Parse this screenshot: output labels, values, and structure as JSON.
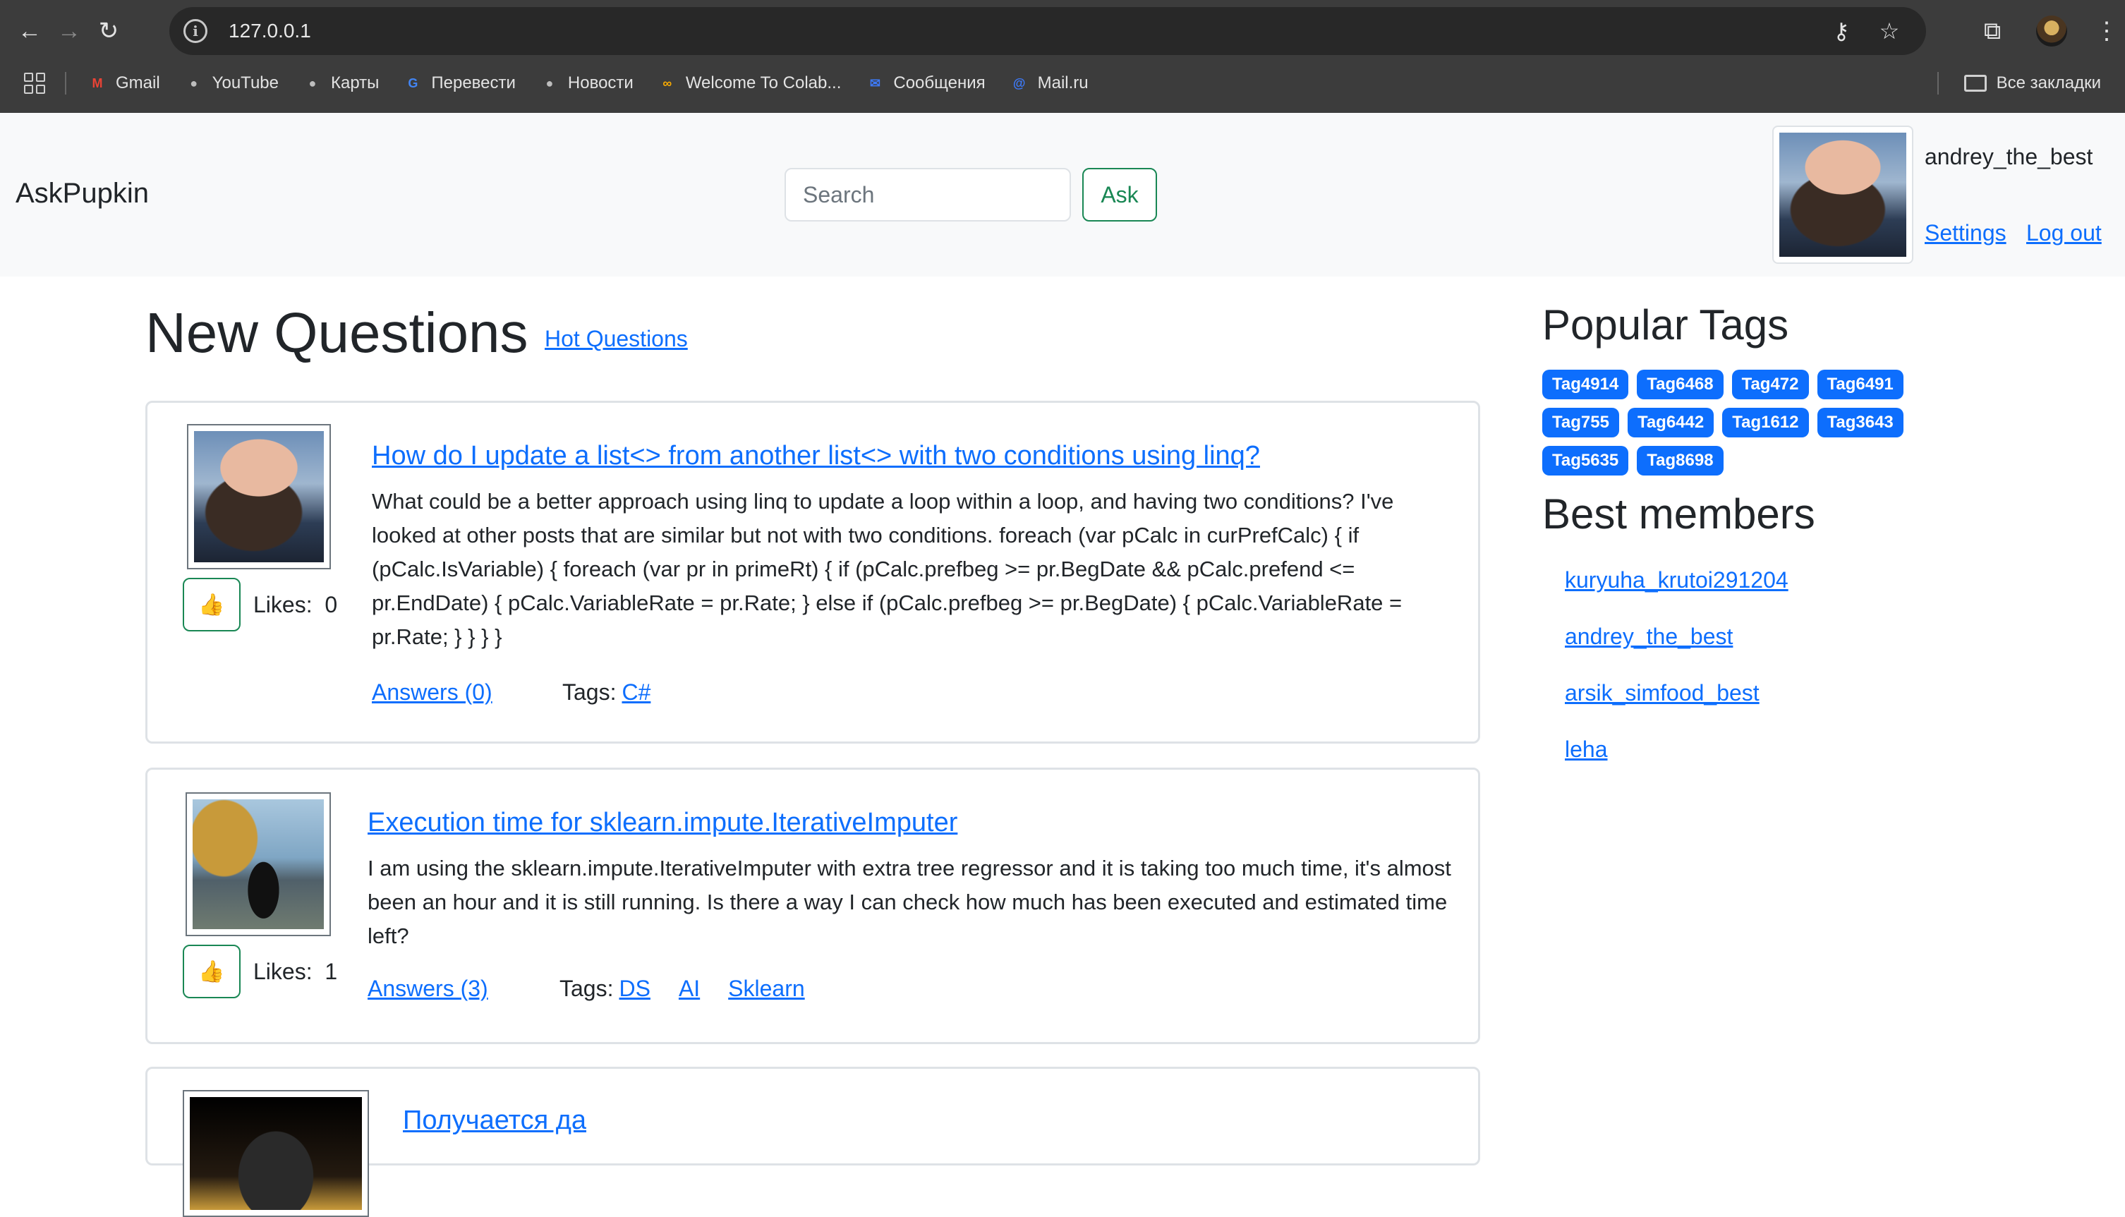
{
  "browser": {
    "url": "127.0.0.1",
    "bookmarks": [
      {
        "label": "Gmail",
        "icon": "gmail-icon",
        "color": "#ea4335",
        "glyph": "M"
      },
      {
        "label": "YouTube",
        "icon": "globe-icon",
        "color": "#bdbdbd",
        "glyph": "●"
      },
      {
        "label": "Карты",
        "icon": "globe-icon",
        "color": "#bdbdbd",
        "glyph": "●"
      },
      {
        "label": "Перевести",
        "icon": "translate-icon",
        "color": "#4285f4",
        "glyph": "G"
      },
      {
        "label": "Новости",
        "icon": "globe-icon",
        "color": "#bdbdbd",
        "glyph": "●"
      },
      {
        "label": "Welcome To Colab...",
        "icon": "colab-icon",
        "color": "#f9ab00",
        "glyph": "∞"
      },
      {
        "label": "Сообщения",
        "icon": "messages-icon",
        "color": "#3d7bfd",
        "glyph": "✉"
      },
      {
        "label": "Mail.ru",
        "icon": "mailru-icon",
        "color": "#3d7bfd",
        "glyph": "@"
      }
    ],
    "all_bookmarks": "Все закладки"
  },
  "header": {
    "brand": "AskPupkin",
    "search_placeholder": "Search",
    "ask_label": "Ask",
    "username": "andrey_the_best",
    "settings_label": "Settings",
    "logout_label": "Log out"
  },
  "main": {
    "title": "New Questions",
    "hot_link": "Hot Questions",
    "like_icon": "👍",
    "likes_label": "Likes:",
    "tags_label": "Tags:",
    "questions": [
      {
        "title": "How do I update a list<> from another list<> with two conditions using linq?",
        "body": "What could be a better approach using linq to update a loop within a loop, and having two conditions? I've looked at other posts that are similar but not with two conditions. foreach (var pCalc in curPrefCalc) { if (pCalc.IsVariable) { foreach (var pr in primeRt) { if (pCalc.prefbeg >= pr.BegDate && pCalc.prefend <= pr.EndDate) { pCalc.VariableRate = pr.Rate; } else if (pCalc.prefbeg >= pr.BegDate) { pCalc.VariableRate = pr.Rate; } } } }",
        "likes": "0",
        "answers": "Answers (0)",
        "tags": [
          "C#"
        ]
      },
      {
        "title": "Execution time for sklearn.impute.IterativeImputer",
        "body": "I am using the sklearn.impute.IterativeImputer with extra tree regressor and it is taking too much time, it's almost been an hour and it is still running. Is there a way I can check how much has been executed and estimated time left?",
        "likes": "1",
        "answers": "Answers (3)",
        "tags": [
          "DS",
          "AI",
          "Sklearn"
        ]
      },
      {
        "title": "Получается да"
      }
    ]
  },
  "sidebar": {
    "tags_title": "Popular Tags",
    "tags": [
      "Tag4914",
      "Tag6468",
      "Tag472",
      "Tag6491",
      "Tag755",
      "Tag6442",
      "Tag1612",
      "Tag3643",
      "Tag5635",
      "Tag8698"
    ],
    "members_title": "Best members",
    "members": [
      "kuryuha_krutoi291204",
      "andrey_the_best",
      "arsik_simfood_best",
      "leha"
    ]
  },
  "colors": {
    "primary": "#0d6efd",
    "success": "#198754",
    "navbar_bg": "#f8f9fa",
    "chrome_bg": "#3c3c3c"
  }
}
